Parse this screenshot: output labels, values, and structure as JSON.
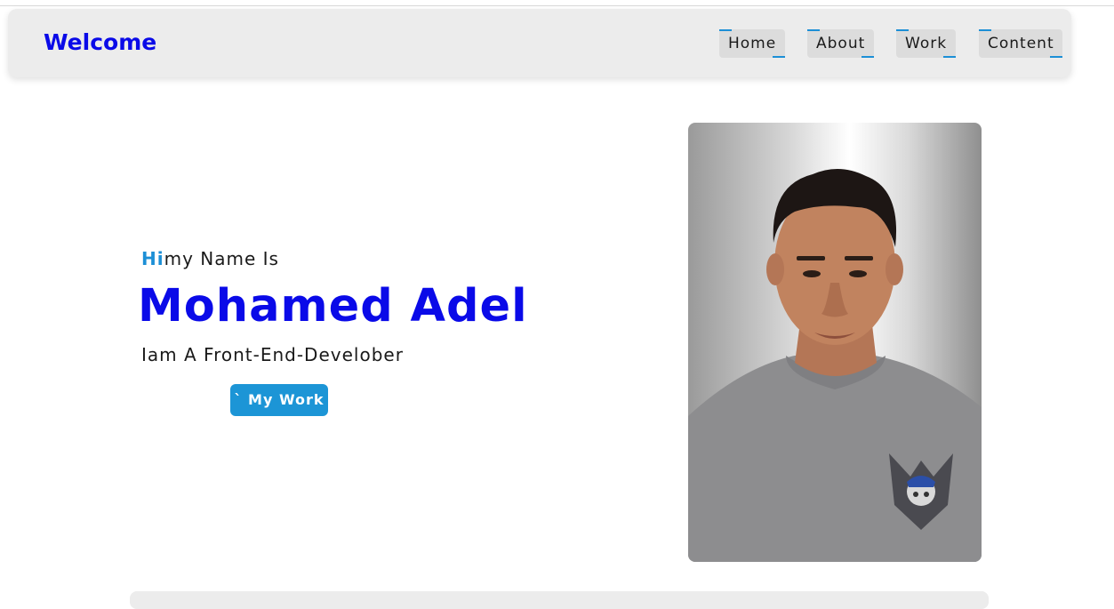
{
  "header": {
    "brand": "Welcome",
    "nav": [
      {
        "label": "Home"
      },
      {
        "label": "About"
      },
      {
        "label": "Work"
      },
      {
        "label": "Content"
      }
    ]
  },
  "hero": {
    "greeting_accent": "Hi",
    "greeting_rest": "my Name Is",
    "name": "Mohamed Adel",
    "role": "Iam A Front-End-Develober",
    "cta_label": "` My Work `"
  },
  "colors": {
    "brand_blue": "#0a0ae8",
    "accent": "#1c95d6",
    "nav_bg": "#ececec"
  },
  "photo": {
    "icon": "profile-photo"
  }
}
